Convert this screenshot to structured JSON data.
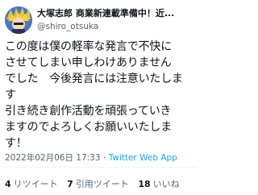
{
  "author": {
    "display_name": "大塚志郎 商業新連載準備中！近...",
    "handle": "@shiro_otsuka"
  },
  "tweet": {
    "text": "この度は僕の軽率な発言で不快に\nさせてしまい申しわけありません\nでした　今後発言には注意いたしま\nす\n引き続き創作活動を頑張っていき\nますのでよろしくお願いいたしま\nす！",
    "timestamp": "2022年02月06日 17:33",
    "separator": " · ",
    "source": "Twitter Web App"
  },
  "stats": {
    "retweets": {
      "count": "4",
      "label": "リツイート"
    },
    "quotes": {
      "count": "7",
      "label": "引用ツイート"
    },
    "likes": {
      "count": "18",
      "label": "いいね"
    }
  },
  "colors": {
    "text": "#0f1419",
    "secondary": "#536471",
    "link": "#1d9bf0",
    "divider": "#eff3f4"
  }
}
